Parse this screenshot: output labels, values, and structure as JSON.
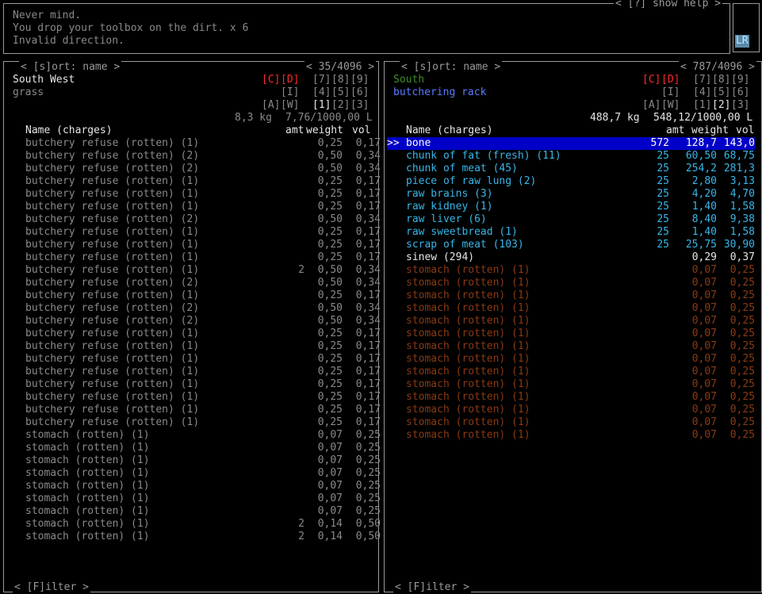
{
  "messages": {
    "help_label": "< [?] show help >",
    "lines": [
      "Never mind.",
      "You drop your toolbox on the dirt. x 6",
      "Invalid direction."
    ],
    "lr_badge": "LR"
  },
  "left": {
    "sort_label": "< [s]ort: name >",
    "count": "< 35/4096 >",
    "location": "South West",
    "terrain": "grass",
    "keys_row1": {
      "c": "[C]",
      "d": "[D]",
      "k7": "[7]",
      "k8": "[8]",
      "k9": "[9]"
    },
    "keys_row2": {
      "i": "[I]",
      "k4": "[4]",
      "k5": "[5]",
      "k6": "[6]"
    },
    "keys_row3": {
      "a": "[A]",
      "w": "[W]",
      "k1": "[1]",
      "k2": "[2]",
      "k3": "[3]"
    },
    "weight_total": "8,3 kg",
    "volume_total": "7,76/1000,00 L",
    "headers": {
      "name": "Name (charges)",
      "amt": "amt",
      "weight": "weight",
      "vol": "vol"
    },
    "filter": "< [F]ilter >",
    "items": [
      {
        "name": "butchery refuse (rotten) (1)",
        "amt": "",
        "weight": "0,25",
        "vol": "0,17"
      },
      {
        "name": "butchery refuse (rotten) (2)",
        "amt": "",
        "weight": "0,50",
        "vol": "0,34"
      },
      {
        "name": "butchery refuse (rotten) (2)",
        "amt": "",
        "weight": "0,50",
        "vol": "0,34"
      },
      {
        "name": "butchery refuse (rotten) (1)",
        "amt": "",
        "weight": "0,25",
        "vol": "0,17"
      },
      {
        "name": "butchery refuse (rotten) (1)",
        "amt": "",
        "weight": "0,25",
        "vol": "0,17"
      },
      {
        "name": "butchery refuse (rotten) (1)",
        "amt": "",
        "weight": "0,25",
        "vol": "0,17"
      },
      {
        "name": "butchery refuse (rotten) (2)",
        "amt": "",
        "weight": "0,50",
        "vol": "0,34"
      },
      {
        "name": "butchery refuse (rotten) (1)",
        "amt": "",
        "weight": "0,25",
        "vol": "0,17"
      },
      {
        "name": "butchery refuse (rotten) (1)",
        "amt": "",
        "weight": "0,25",
        "vol": "0,17"
      },
      {
        "name": "butchery refuse (rotten) (1)",
        "amt": "",
        "weight": "0,25",
        "vol": "0,17"
      },
      {
        "name": "butchery refuse (rotten) (1)",
        "amt": "2",
        "weight": "0,50",
        "vol": "0,34"
      },
      {
        "name": "butchery refuse (rotten) (2)",
        "amt": "",
        "weight": "0,50",
        "vol": "0,34"
      },
      {
        "name": "butchery refuse (rotten) (1)",
        "amt": "",
        "weight": "0,25",
        "vol": "0,17"
      },
      {
        "name": "butchery refuse (rotten) (2)",
        "amt": "",
        "weight": "0,50",
        "vol": "0,34"
      },
      {
        "name": "butchery refuse (rotten) (2)",
        "amt": "",
        "weight": "0,50",
        "vol": "0,34"
      },
      {
        "name": "butchery refuse (rotten) (1)",
        "amt": "",
        "weight": "0,25",
        "vol": "0,17"
      },
      {
        "name": "butchery refuse (rotten) (1)",
        "amt": "",
        "weight": "0,25",
        "vol": "0,17"
      },
      {
        "name": "butchery refuse (rotten) (1)",
        "amt": "",
        "weight": "0,25",
        "vol": "0,17"
      },
      {
        "name": "butchery refuse (rotten) (1)",
        "amt": "",
        "weight": "0,25",
        "vol": "0,17"
      },
      {
        "name": "butchery refuse (rotten) (1)",
        "amt": "",
        "weight": "0,25",
        "vol": "0,17"
      },
      {
        "name": "butchery refuse (rotten) (1)",
        "amt": "",
        "weight": "0,25",
        "vol": "0,17"
      },
      {
        "name": "butchery refuse (rotten) (1)",
        "amt": "",
        "weight": "0,25",
        "vol": "0,17"
      },
      {
        "name": "butchery refuse (rotten) (1)",
        "amt": "",
        "weight": "0,25",
        "vol": "0,17"
      },
      {
        "name": "stomach (rotten) (1)",
        "amt": "",
        "weight": "0,07",
        "vol": "0,25"
      },
      {
        "name": "stomach (rotten) (1)",
        "amt": "",
        "weight": "0,07",
        "vol": "0,25"
      },
      {
        "name": "stomach (rotten) (1)",
        "amt": "",
        "weight": "0,07",
        "vol": "0,25"
      },
      {
        "name": "stomach (rotten) (1)",
        "amt": "",
        "weight": "0,07",
        "vol": "0,25"
      },
      {
        "name": "stomach (rotten) (1)",
        "amt": "",
        "weight": "0,07",
        "vol": "0,25"
      },
      {
        "name": "stomach (rotten) (1)",
        "amt": "",
        "weight": "0,07",
        "vol": "0,25"
      },
      {
        "name": "stomach (rotten) (1)",
        "amt": "",
        "weight": "0,07",
        "vol": "0,25"
      },
      {
        "name": "stomach (rotten) (1)",
        "amt": "2",
        "weight": "0,14",
        "vol": "0,50"
      },
      {
        "name": "stomach (rotten) (1)",
        "amt": "2",
        "weight": "0,14",
        "vol": "0,50"
      }
    ]
  },
  "right": {
    "sort_label": "< [s]ort: name >",
    "count": "< 787/4096 >",
    "location": "South",
    "terrain": "butchering rack",
    "keys_row1": {
      "c": "[C]",
      "d": "[D]",
      "k7": "[7]",
      "k8": "[8]",
      "k9": "[9]"
    },
    "keys_row2": {
      "i": "[I]",
      "k4": "[4]",
      "k5": "[5]",
      "k6": "[6]"
    },
    "keys_row3": {
      "a": "[A]",
      "w": "[W]",
      "k1": "[1]",
      "k2": "[2]",
      "k3": "[3]"
    },
    "weight_total": "488,7 kg",
    "volume_total": "548,12/1000,00 L",
    "headers": {
      "name": "Name (charges)",
      "amt": "amt",
      "weight": "weight",
      "vol": "vol"
    },
    "cursor": ">>",
    "filter": "< [F]ilter >",
    "items": [
      {
        "name": "bone",
        "amt": "572",
        "weight": "128,7",
        "vol": "143,0",
        "color": "sel"
      },
      {
        "name": "chunk of fat (fresh) (11)",
        "amt": "25",
        "weight": "60,50",
        "vol": "68,75",
        "color": "cyan"
      },
      {
        "name": "chunk of meat (45)",
        "amt": "25",
        "weight": "254,2",
        "vol": "281,3",
        "color": "cyan"
      },
      {
        "name": "piece of raw lung (2)",
        "amt": "25",
        "weight": "2,80",
        "vol": "3,13",
        "color": "cyan"
      },
      {
        "name": "raw brains (3)",
        "amt": "25",
        "weight": "4,20",
        "vol": "4,70",
        "color": "cyan"
      },
      {
        "name": "raw kidney (1)",
        "amt": "25",
        "weight": "1,40",
        "vol": "1,58",
        "color": "cyan"
      },
      {
        "name": "raw liver (6)",
        "amt": "25",
        "weight": "8,40",
        "vol": "9,38",
        "color": "cyan"
      },
      {
        "name": "raw sweetbread (1)",
        "amt": "25",
        "weight": "1,40",
        "vol": "1,58",
        "color": "cyan"
      },
      {
        "name": "scrap of meat (103)",
        "amt": "25",
        "weight": "25,75",
        "vol": "30,90",
        "color": "cyan"
      },
      {
        "name": "sinew (294)",
        "amt": "",
        "weight": "0,29",
        "vol": "0,37",
        "color": "white"
      },
      {
        "name": "stomach (rotten) (1)",
        "amt": "",
        "weight": "0,07",
        "vol": "0,25",
        "color": "brown"
      },
      {
        "name": "stomach (rotten) (1)",
        "amt": "",
        "weight": "0,07",
        "vol": "0,25",
        "color": "brown"
      },
      {
        "name": "stomach (rotten) (1)",
        "amt": "",
        "weight": "0,07",
        "vol": "0,25",
        "color": "brown"
      },
      {
        "name": "stomach (rotten) (1)",
        "amt": "",
        "weight": "0,07",
        "vol": "0,25",
        "color": "brown"
      },
      {
        "name": "stomach (rotten) (1)",
        "amt": "",
        "weight": "0,07",
        "vol": "0,25",
        "color": "brown"
      },
      {
        "name": "stomach (rotten) (1)",
        "amt": "",
        "weight": "0,07",
        "vol": "0,25",
        "color": "brown"
      },
      {
        "name": "stomach (rotten) (1)",
        "amt": "",
        "weight": "0,07",
        "vol": "0,25",
        "color": "brown"
      },
      {
        "name": "stomach (rotten) (1)",
        "amt": "",
        "weight": "0,07",
        "vol": "0,25",
        "color": "brown"
      },
      {
        "name": "stomach (rotten) (1)",
        "amt": "",
        "weight": "0,07",
        "vol": "0,25",
        "color": "brown"
      },
      {
        "name": "stomach (rotten) (1)",
        "amt": "",
        "weight": "0,07",
        "vol": "0,25",
        "color": "brown"
      },
      {
        "name": "stomach (rotten) (1)",
        "amt": "",
        "weight": "0,07",
        "vol": "0,25",
        "color": "brown"
      },
      {
        "name": "stomach (rotten) (1)",
        "amt": "",
        "weight": "0,07",
        "vol": "0,25",
        "color": "brown"
      },
      {
        "name": "stomach (rotten) (1)",
        "amt": "",
        "weight": "0,07",
        "vol": "0,25",
        "color": "brown"
      },
      {
        "name": "stomach (rotten) (1)",
        "amt": "",
        "weight": "0,07",
        "vol": "0,25",
        "color": "brown"
      }
    ]
  }
}
